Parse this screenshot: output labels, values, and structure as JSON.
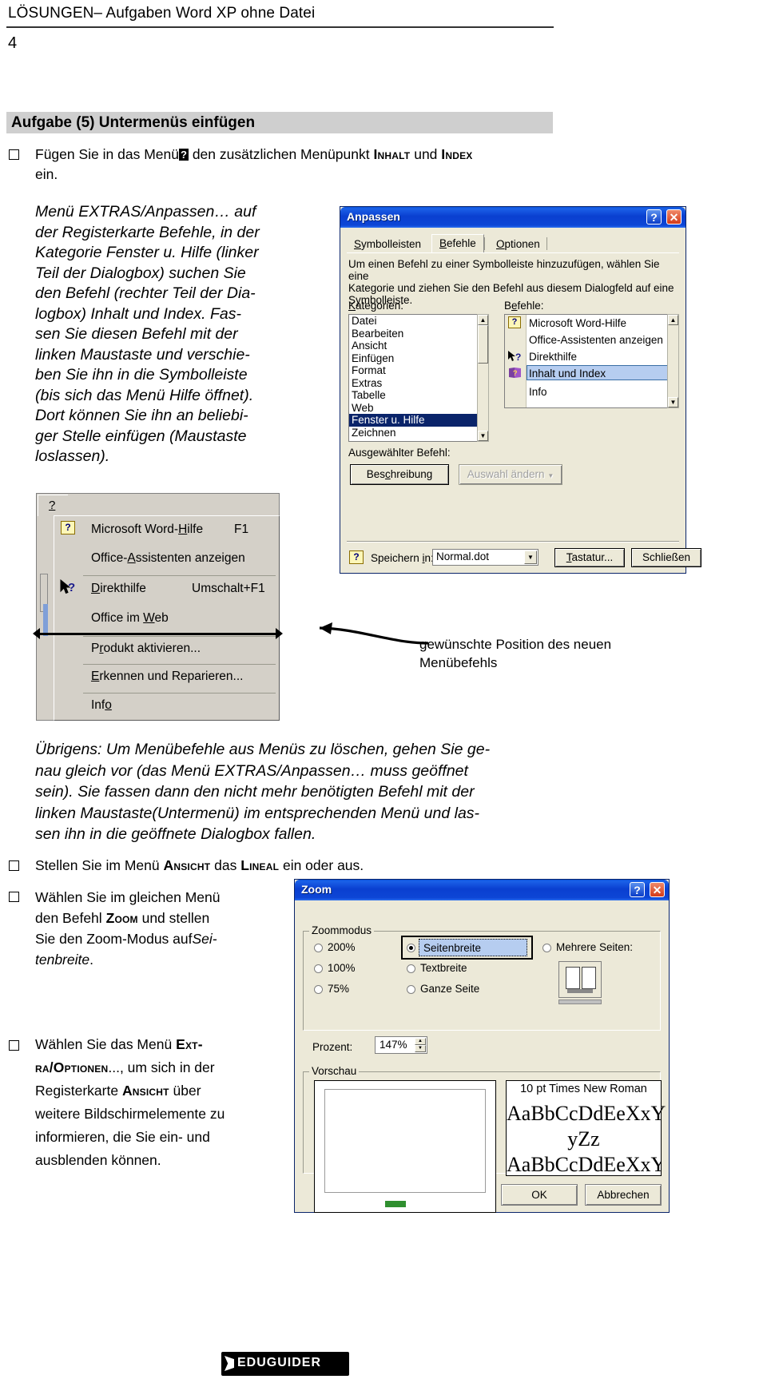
{
  "page": {
    "header_title": "LÖSUNGEN– Aufgaben Word XP ohne Datei",
    "page_number": "4",
    "task_heading": "Aufgabe (5) Untermenüs einfügen"
  },
  "tasks": {
    "t1_a": "Fügen Sie in das Menü",
    "t1_badge": "?",
    "t1_b": "den zusätzlichen Menüpunkt",
    "t1_sc1": "Inhalt",
    "t1_c": "und",
    "t1_sc2": "Index",
    "t1_d": "ein.",
    "t2_a": "Stellen Sie im Menü",
    "t2_sc1": "Ansicht",
    "t2_b": "das",
    "t2_sc2": "Lineal",
    "t2_c": "ein oder aus.",
    "t3_l1": "Wählen Sie im gleichen Menü",
    "t3_l2_a": "den Befehl",
    "t3_l2_sc": "Zoom",
    "t3_l2_b": "und stellen",
    "t3_l3": "Sie den Zoom-Modus auf",
    "t3_l3_i": "Sei-",
    "t3_l4_i": "tenbreite",
    "t3_l4_b": ".",
    "t4_l1_a": "Wählen Sie das Menü",
    "t4_l1_sc": "Ext-",
    "t4_l2_sc": "ra/Optionen",
    "t4_l2_b": "..., um sich in der",
    "t4_l3_a": "Registerkarte",
    "t4_l3_sc": "Ansicht",
    "t4_l3_b": "über",
    "t4_l4": "weitere Bildschirmelemente zu",
    "t4_l5": "informieren, die Sie ein- und",
    "t4_l6": "ausblenden können."
  },
  "solution_italic": {
    "lines": [
      "Menü EXTRAS/Anpassen… auf",
      "der Registerkarte Befehle, in der",
      "Kategorie Fenster u. Hilfe (linker",
      "Teil der Dialogbox) suchen Sie",
      "den Befehl (rechter Teil der Dia-",
      "logbox) Inhalt und Index. Fas-",
      "sen Sie diesen Befehl mit der",
      "linken Maustaste und verschie-",
      "ben Sie ihn in die Symbolleiste",
      "(bis sich das Menü Hilfe öffnet).",
      "Dort können Sie ihn an beliebi-",
      "ger Stelle einfügen (Maustaste",
      "loslassen)."
    ]
  },
  "note_uebrigens": {
    "lines": [
      "Übrigens: Um Menübefehle aus Menüs zu löschen, gehen Sie ge-",
      "nau gleich vor (das Menü EXTRAS/Anpassen… muss geöffnet",
      "sein). Sie fassen dann den nicht mehr benötigten Befehl mit der",
      "linken Maustaste(Untermenü) im entsprechenden Menü und las-",
      "sen ihn in die geöffnete Dialogbox fallen."
    ]
  },
  "callout": {
    "line1": "gewünschte Position des neuen",
    "line2": "Menübefehls"
  },
  "anpassen_dialog": {
    "title": "Anpassen",
    "help_btn": "?",
    "close_btn": "✕",
    "tabs": [
      {
        "label": "Symbolleisten",
        "active": false
      },
      {
        "label": "Befehle",
        "active": true
      },
      {
        "label": "Optionen",
        "active": false
      }
    ],
    "hint": [
      "Um einen Befehl zu einer Symbolleiste hinzuzufügen, wählen Sie eine",
      "Kategorie und ziehen Sie den Befehl aus diesem Dialogfeld auf eine",
      "Symbolleiste."
    ],
    "kategorien_label": "Kategorien:",
    "befehle_label": "Befehle:",
    "kategorien": [
      {
        "label": "Datei",
        "selected": false
      },
      {
        "label": "Bearbeiten",
        "selected": false
      },
      {
        "label": "Ansicht",
        "selected": false
      },
      {
        "label": "Einfügen",
        "selected": false
      },
      {
        "label": "Format",
        "selected": false
      },
      {
        "label": "Extras",
        "selected": false
      },
      {
        "label": "Tabelle",
        "selected": false
      },
      {
        "label": "Web",
        "selected": false
      },
      {
        "label": "Fenster u. Hilfe",
        "selected": true
      },
      {
        "label": "Zeichnen",
        "selected": false
      }
    ],
    "befehle": [
      {
        "label": "Microsoft Word-Hilfe",
        "icon": "help-balloon-icon",
        "selected": false
      },
      {
        "label": "Office-Assistenten anzeigen",
        "icon": "none",
        "selected": false
      },
      {
        "label": "Direkthilfe",
        "icon": "pointer-question-icon",
        "selected": false
      },
      {
        "label": "Inhalt und Index",
        "icon": "book-question-icon",
        "selected": true
      },
      {
        "label": "Info",
        "icon": "none",
        "selected": false
      }
    ],
    "ausgewaehlter_label": "Ausgewählter Befehl:",
    "beschreibung_btn": "Beschreibung",
    "auswahl_btn": "Auswahl ändern",
    "speichern_label": "Speichern in:",
    "speichern_value": "Normal.dot",
    "tastatur_btn": "Tastatur...",
    "schliessen_btn": "Schließen"
  },
  "help_menu": {
    "menu_button": "?",
    "items": [
      {
        "label": "Microsoft Word-Hilfe",
        "shortcut": "F1",
        "icon": "help-balloon-icon"
      },
      {
        "label": "Office-Assistenten anzeigen",
        "shortcut": "",
        "icon": "none"
      },
      {
        "label": "Direkthilfe",
        "shortcut": "Umschalt+F1",
        "icon": "pointer-question-icon"
      },
      {
        "label": "Office im Web",
        "shortcut": "",
        "icon": "none"
      },
      {
        "label": "Produkt aktivieren...",
        "shortcut": "",
        "icon": "none"
      },
      {
        "label": "Erkennen und Reparieren...",
        "shortcut": "",
        "icon": "none"
      },
      {
        "label": "Info",
        "shortcut": "",
        "icon": "none"
      }
    ]
  },
  "zoom_dialog": {
    "title": "Zoom",
    "help_btn": "?",
    "close_btn": "✕",
    "group_zoommodus": "Zoommodus",
    "group_vorschau": "Vorschau",
    "radios_left": [
      {
        "label": "200%",
        "checked": false
      },
      {
        "label": "100%",
        "checked": false
      },
      {
        "label": "75%",
        "checked": false
      }
    ],
    "radios_mid": [
      {
        "label": "Seitenbreite",
        "checked": true
      },
      {
        "label": "Textbreite",
        "checked": false
      },
      {
        "label": "Ganze Seite",
        "checked": false
      }
    ],
    "radios_right": [
      {
        "label": "Mehrere Seiten:",
        "checked": false
      }
    ],
    "prozent_label": "Prozent:",
    "prozent_value": "147%",
    "font_note": "10 pt Times New Roman",
    "sample_l1": "AaBbCcDdEeXxY",
    "sample_l2": "yZz",
    "sample_l3": "AaBbCcDdEeXxY",
    "ok_btn": "OK",
    "cancel_btn": "Abbrechen"
  },
  "footer": {
    "logo_text": "EDUGUIDER"
  },
  "colors": {
    "titlebar_blue": "#0a3fd0",
    "dialog_face": "#ece9d8",
    "selection_blue": "#0a246a",
    "light_selection": "#b6cdf0",
    "band_gray": "#cfcfcf"
  }
}
